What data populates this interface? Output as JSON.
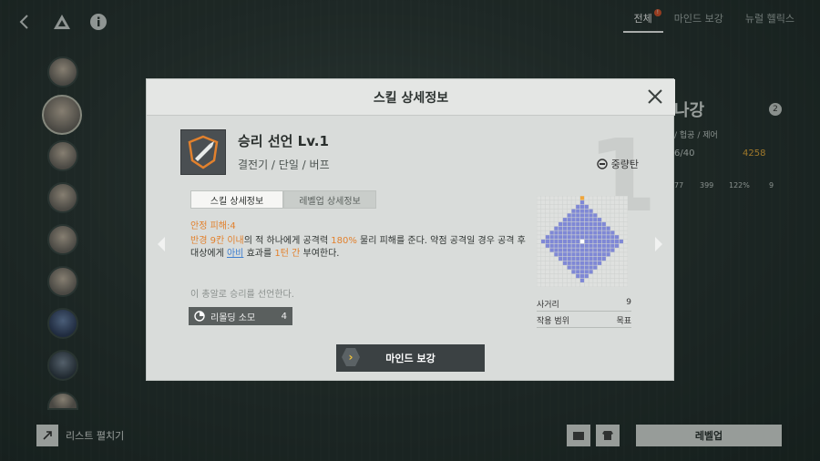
{
  "top_tabs": [
    {
      "label": "전체",
      "active": true
    },
    {
      "label": "마인드 보강",
      "active": false
    },
    {
      "label": "뉴럴 헬릭스",
      "active": false
    }
  ],
  "badge_text": "!",
  "right_fragment": {
    "name_partial": "나강",
    "sub": "/ 헙공 / 제어",
    "count": "6/40",
    "coin": "4258",
    "level_badge": "2",
    "stats": [
      "77",
      "399",
      "122%",
      "9"
    ]
  },
  "bottom": {
    "list_expand": "리스트 펼치기",
    "level_up": "레벨업"
  },
  "modal": {
    "title": "스킬 상세정보",
    "watermark": "1",
    "skill_name": "승리 선언 Lv.1",
    "skill_type": "결전기 / 단일 / 버프",
    "ammo_type": "중량탄",
    "tabs": [
      {
        "label": "스킬 상세정보"
      },
      {
        "label": "레벨업 상세정보"
      }
    ],
    "stable_damage": "안정 피해:4",
    "desc": {
      "p1": "반경 9칸 이내",
      "p2": "의 적 하나에게 공격력 ",
      "p3": "180%",
      "p4": " 물리 피해를 준다. 약점 공격일 경우 공격 후 대상에게 ",
      "p5": "아비",
      "p6": " 효과를 ",
      "p7": "1턴 간",
      "p8": " 부여한다."
    },
    "flavor": "이 총알로 승리를 선언한다.",
    "reload_label": "리몰딩 소모",
    "reload_value": "4",
    "range_label": "사거리",
    "range_value": "9",
    "scope_label": "작용 범위",
    "scope_value": "목표",
    "main_button": "마인드 보강"
  },
  "colors": {
    "accent_orange": "#e2812d",
    "link_blue": "#3f7fcf",
    "range_cell": "#7f88d6"
  }
}
